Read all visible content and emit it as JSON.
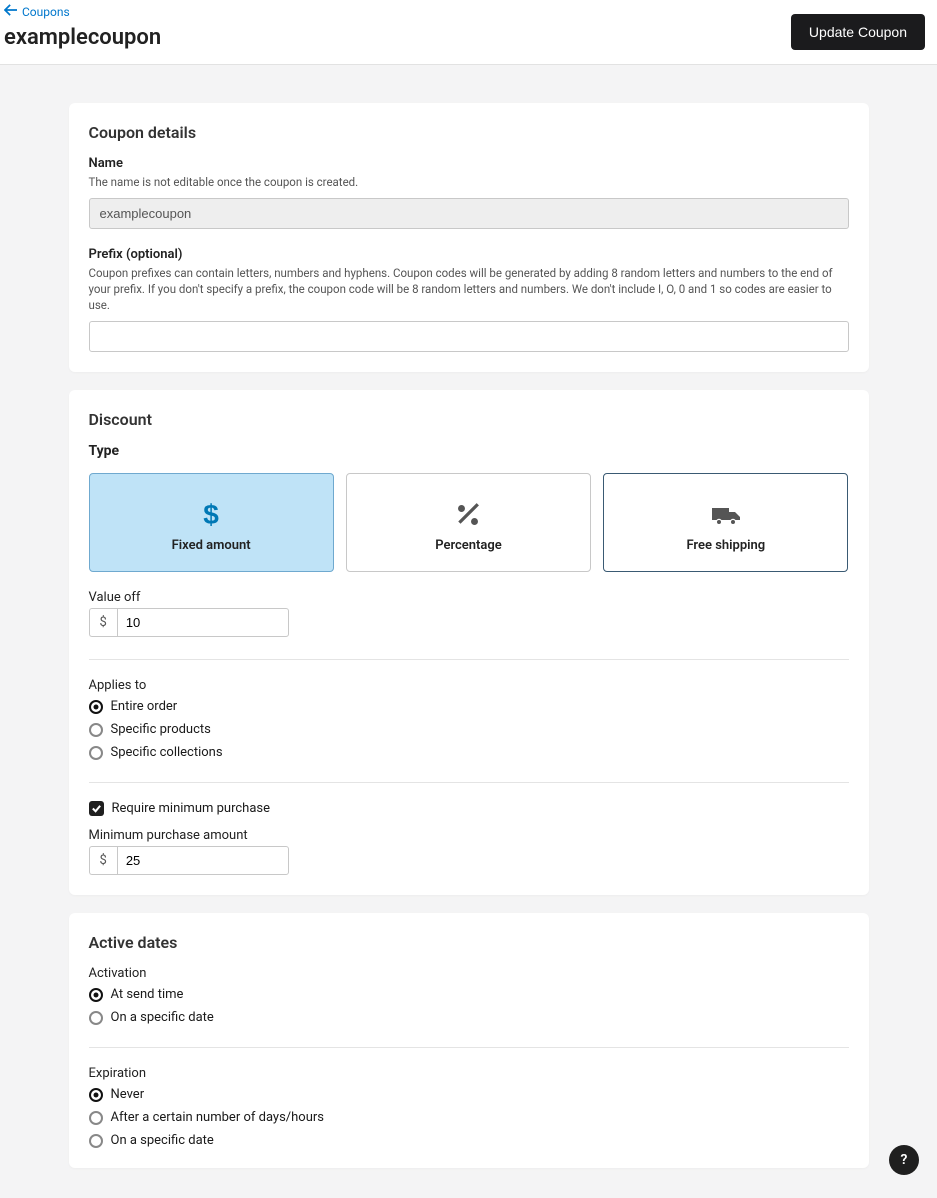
{
  "breadcrumb": {
    "back_label": "Coupons"
  },
  "page": {
    "title": "examplecoupon"
  },
  "actions": {
    "update_label": "Update Coupon"
  },
  "details": {
    "section_title": "Coupon details",
    "name_label": "Name",
    "name_help": "The name is not editable once the coupon is created.",
    "name_value": "examplecoupon",
    "prefix_label": "Prefix (optional)",
    "prefix_help": "Coupon prefixes can contain letters, numbers and hyphens. Coupon codes will be generated by adding 8 random letters and numbers to the end of your prefix. If you don't specify a prefix, the coupon code will be 8 random letters and numbers. We don't include I, O, 0 and 1 so codes are easier to use.",
    "prefix_value": ""
  },
  "discount": {
    "section_title": "Discount",
    "type_label": "Type",
    "types": {
      "fixed": "Fixed amount",
      "percentage": "Percentage",
      "free_shipping": "Free shipping"
    },
    "value_off_label": "Value off",
    "currency_symbol": "$",
    "value_off": "10",
    "applies_to_label": "Applies to",
    "applies_to_options": {
      "entire_order": "Entire order",
      "specific_products": "Specific products",
      "specific_collections": "Specific collections"
    },
    "require_min_label": "Require minimum purchase",
    "min_purchase_label": "Minimum purchase amount",
    "min_purchase_value": "25"
  },
  "active_dates": {
    "section_title": "Active dates",
    "activation_label": "Activation",
    "activation_options": {
      "at_send": "At send time",
      "specific_date": "On a specific date"
    },
    "expiration_label": "Expiration",
    "expiration_options": {
      "never": "Never",
      "after_days": "After a certain number of days/hours",
      "specific_date": "On a specific date"
    }
  },
  "help": {
    "label": "?"
  }
}
